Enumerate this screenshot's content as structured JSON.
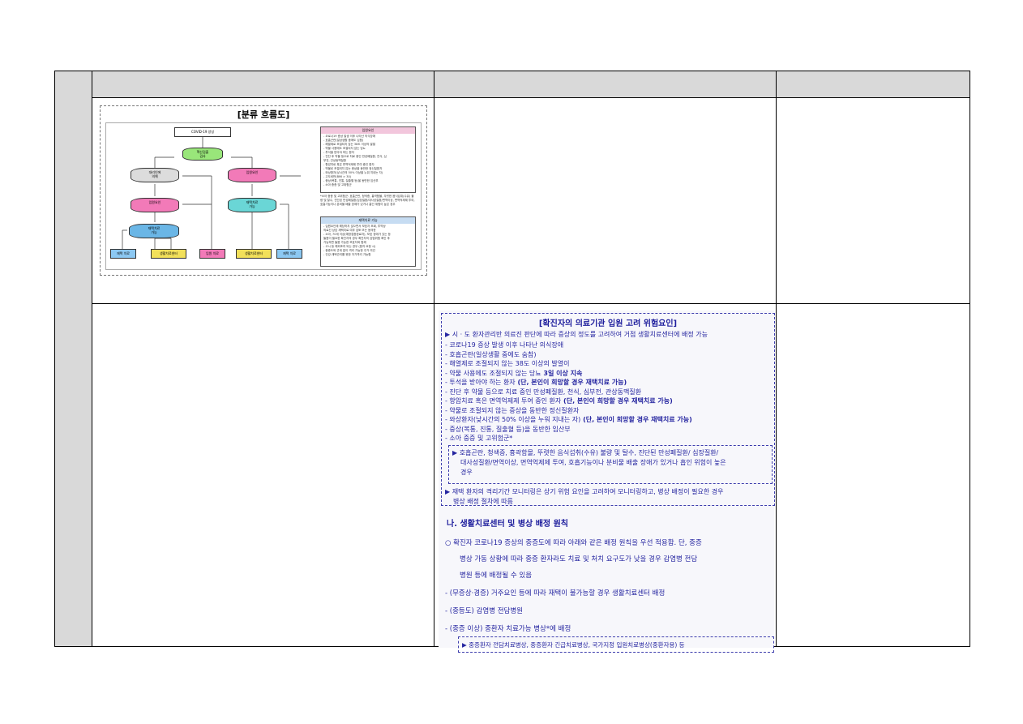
{
  "flowchart": {
    "title": "[분류 흐름도]",
    "start": "COVID-19 양성",
    "d1": "핵산검출\n검사",
    "d2": "대리인에\n의해",
    "d3": "입원요인",
    "d4": "입원요인",
    "d5": "재택치료\n가능",
    "d6": "재택치료\n가능",
    "labels": {
      "yes": "예",
      "no": "아니요"
    },
    "out1": "재택 치료",
    "out2": "생활치료센터",
    "out3": "입원 치료",
    "out4": "생활치료센터",
    "out5": "재택 치료",
    "side1_title": "입원요인",
    "side1_lines": [
      "- 코로나19 증상 발생 이후 나타난 의식장애",
      "- 호흡곤란(일상생활 중에도 심함)",
      "- 해열제로 조절되지 않는 38도 이상의 발열",
      "- 약물 사용에도 조절되지 않는 당뇨",
      "- 투석을 받아야 하는 환자",
      "- 진단 후 약물 등으로 치료 중인 만성폐질환, 천식, 심",
      "  부전, 관상동맥질환",
      "- 항암치료 혹은 면역억제제 투여 중인 환자",
      "- 약물로 조절되지 않는 증상을 동반한 정신질환자",
      "- 와상환자(낮시간의 50% 이상을 누워 지내는 자)",
      "- 고도비만(BMI > 30)",
      "- 중상(복통, 진통, 질출혈 등)을 동반한 임산부",
      "- 소아 중증 및 고위험군"
    ],
    "note": "*소아 중증 및 고위험군: 호흡곤란, 청색증, 흉곽함몰, 뚜렷한 음식섭취(수유) 불량 및 탈수, 진단된 만성폐질환/심장질환/대사성질환/면역이상, 면역억제제 투여, 호흡기능이나 분비물 배출 장애가 있거나 흡인 위험이 높은 경우",
    "side2_title": "재택치료 가능",
    "side2_lines": [
      "- 입원요인에 해당하지 않으면서 보호자 조회, 투약상",
      "  의료진 상담 재택치료 여부 검토 또는 동의한",
      "- 소아, 70세 이상(예방접종완료자), 보호 장애가 있는 등",
      "  돌봄이 필요한 확진자의 경우 확진자의 감염위험 확인 후",
      "  가능하면 돌봄 가능한 보호자와 함께",
      "- 고시 등 예외조치 되는 경우 (환자 요청 시)",
      "- 중증도와 관계 없이 격리 가능한 주거 여건",
      "- 건강-재택관리를 위한 자가격리 가능함"
    ]
  },
  "risk": {
    "title": "[확진자의 의료기관 입원 고려 위험요인]",
    "intro": "▶ 시 · 도 환자관리반 의료진 판단에 따라 증상의 정도를 고려하여 거점 생활치료센터에 배정 가능",
    "items": [
      "- 코로나19 증상 발생 이후 나타난 의식장애",
      "- 호흡곤란(일상생활 중에도 숨참)",
      "- 해열제로 조절되지 않는 38도 이상의 발열이",
      "- 약물 사용에도 조절되지 않는 당뇨",
      "- 투석을 받아야 하는 환자",
      "- 진단 후 약물 등으로 치료 중인 만성폐질환, 천식, 심부전, 관상동맥질환",
      "- 항암치료 혹은 면역억제제 투여 중인 환자",
      "- 약물로 조절되지 않는 증상을 동반한 정신질환자",
      "- 와상환자(낮시간의 50% 이상을 누워 지내는 자)",
      "- 중상(복통, 진통, 질출혈 등)을 동반한 임산부",
      "- 소아 중증 및 고위험군*"
    ],
    "item2_bold": "3일 이상 지속",
    "bold_suffix": "(단, 본인이 희망할 경우 재택치료 가능)",
    "child_note_1": "▶ 호흡곤란, 청색증, 흉곽함몰, 뚜렷한 음식섭취(수유) 불량 및 탈수, 진단된 만성폐질환/ 심장질환/",
    "child_note_2": "대사성질환/면역이상, 면역억제제 투여, 호흡기능이나 분비물 배출 장애가 있거나 흡인 위험이 높은",
    "child_note_3": "경우",
    "home_note_1": "▶ 재택 환자의 격리기간 모니터링은 상기 위험 요인을 고려하여 모니터링하고, 병상 배정이 필요한 경우",
    "home_note_2": "병상 배정 절차에 따름",
    "section_title": "나. 생활치료센터 및 병상 배정 원칙",
    "principle_1": "○ 확진자 코로나19 증상의 중증도에 따라 아래와 같은 배정 원칙을 우선 적용함. 단, 중증",
    "principle_2": "병상 가동 상황에 따라 중증 환자라도 치료 및 처치 요구도가 낮을 경우 감염병 전담",
    "principle_3": "병원 등에 배정될 수 있음",
    "rule1": "- (무증상·경증) 거주요인 등에 따라 재택이 불가능할 경우 생활치료센터 배정",
    "rule2": "- (중등도) 감염병 전담병원",
    "rule3": "- (중증 이상) 중환자 치료가능 병상*에 배정",
    "footnote": "▶ 중증환자 전담치료병상, 중증환자 긴급치료병상, 국가지정 입원치료병상(중환자용) 등"
  }
}
